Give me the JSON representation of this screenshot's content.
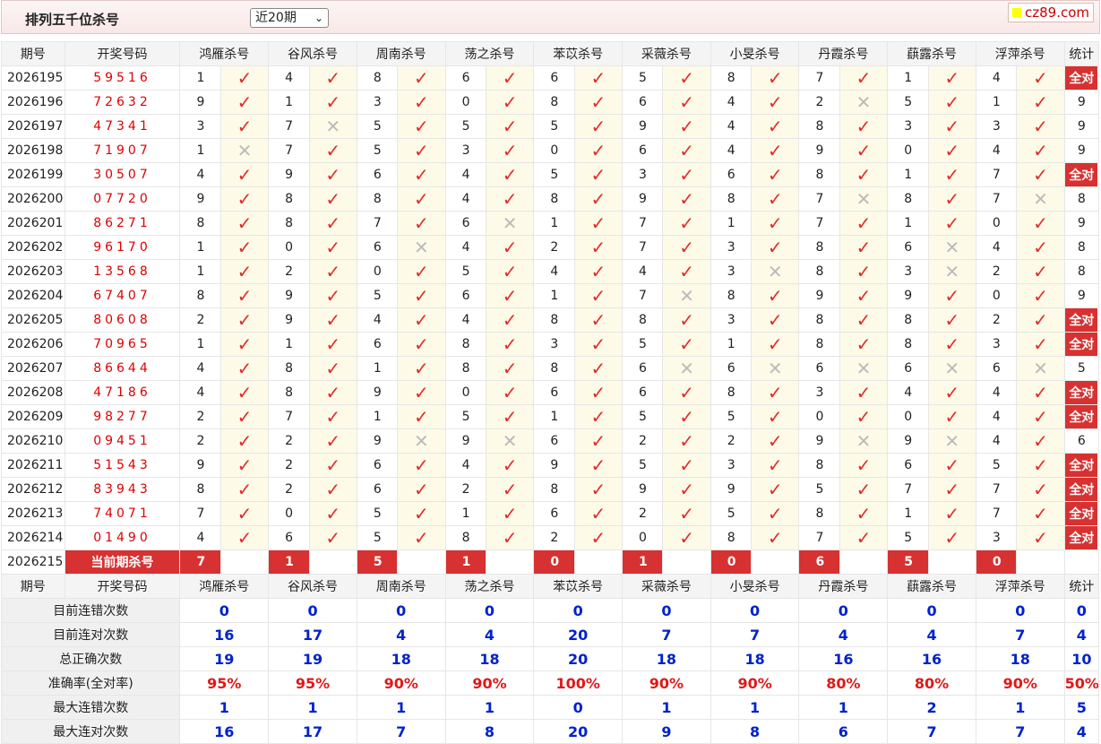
{
  "header": {
    "title": "排列五千位杀号",
    "period_select": "近20期",
    "brand": "cz89.com"
  },
  "columns": {
    "issue": "期号",
    "draw": "开奖号码",
    "experts": [
      "鸿雁杀号",
      "谷风杀号",
      "周南杀号",
      "荡之杀号",
      "苯苡杀号",
      "采薇杀号",
      "小旻杀号",
      "丹霞杀号",
      "蕻露杀号",
      "浮萍杀号"
    ],
    "stat": "统计"
  },
  "marks": {
    "ok": "✓",
    "no": "✕"
  },
  "rows": [
    {
      "issue": "2026195",
      "draw": "59516",
      "kills": [
        1,
        4,
        8,
        6,
        6,
        5,
        8,
        7,
        1,
        4
      ],
      "hits": [
        1,
        1,
        1,
        1,
        1,
        1,
        1,
        1,
        1,
        1
      ],
      "stat": "全对"
    },
    {
      "issue": "2026196",
      "draw": "72632",
      "kills": [
        9,
        1,
        3,
        0,
        8,
        6,
        4,
        2,
        5,
        1
      ],
      "hits": [
        1,
        1,
        1,
        1,
        1,
        1,
        1,
        0,
        1,
        1
      ],
      "stat": "9"
    },
    {
      "issue": "2026197",
      "draw": "47341",
      "kills": [
        3,
        7,
        5,
        5,
        5,
        9,
        4,
        8,
        3,
        3
      ],
      "hits": [
        1,
        0,
        1,
        1,
        1,
        1,
        1,
        1,
        1,
        1
      ],
      "stat": "9"
    },
    {
      "issue": "2026198",
      "draw": "71907",
      "kills": [
        1,
        7,
        5,
        3,
        0,
        6,
        4,
        9,
        0,
        4
      ],
      "hits": [
        0,
        1,
        1,
        1,
        1,
        1,
        1,
        1,
        1,
        1
      ],
      "stat": "9"
    },
    {
      "issue": "2026199",
      "draw": "30507",
      "kills": [
        4,
        9,
        6,
        4,
        5,
        3,
        6,
        8,
        1,
        7
      ],
      "hits": [
        1,
        1,
        1,
        1,
        1,
        1,
        1,
        1,
        1,
        1
      ],
      "stat": "全对"
    },
    {
      "issue": "2026200",
      "draw": "07720",
      "kills": [
        9,
        8,
        8,
        4,
        8,
        9,
        8,
        7,
        8,
        7
      ],
      "hits": [
        1,
        1,
        1,
        1,
        1,
        1,
        1,
        0,
        1,
        0
      ],
      "stat": "8"
    },
    {
      "issue": "2026201",
      "draw": "86271",
      "kills": [
        8,
        8,
        7,
        6,
        1,
        7,
        1,
        7,
        1,
        0
      ],
      "hits": [
        1,
        1,
        1,
        0,
        1,
        1,
        1,
        1,
        1,
        1
      ],
      "stat": "9"
    },
    {
      "issue": "2026202",
      "draw": "96170",
      "kills": [
        1,
        0,
        6,
        4,
        2,
        7,
        3,
        8,
        6,
        4
      ],
      "hits": [
        1,
        1,
        0,
        1,
        1,
        1,
        1,
        1,
        0,
        1
      ],
      "stat": "8"
    },
    {
      "issue": "2026203",
      "draw": "13568",
      "kills": [
        1,
        2,
        0,
        5,
        4,
        4,
        3,
        8,
        3,
        2
      ],
      "hits": [
        1,
        1,
        1,
        1,
        1,
        1,
        0,
        1,
        0,
        1
      ],
      "stat": "8"
    },
    {
      "issue": "2026204",
      "draw": "67407",
      "kills": [
        8,
        9,
        5,
        6,
        1,
        7,
        8,
        9,
        9,
        0
      ],
      "hits": [
        1,
        1,
        1,
        1,
        1,
        0,
        1,
        1,
        1,
        1
      ],
      "stat": "9"
    },
    {
      "issue": "2026205",
      "draw": "80608",
      "kills": [
        2,
        9,
        4,
        4,
        8,
        8,
        3,
        8,
        8,
        2
      ],
      "hits": [
        1,
        1,
        1,
        1,
        1,
        1,
        1,
        1,
        1,
        1
      ],
      "stat": "全对"
    },
    {
      "issue": "2026206",
      "draw": "70965",
      "kills": [
        1,
        1,
        6,
        8,
        3,
        5,
        1,
        8,
        8,
        3
      ],
      "hits": [
        1,
        1,
        1,
        1,
        1,
        1,
        1,
        1,
        1,
        1
      ],
      "stat": "全对"
    },
    {
      "issue": "2026207",
      "draw": "86644",
      "kills": [
        4,
        8,
        1,
        8,
        8,
        6,
        6,
        6,
        6,
        6
      ],
      "hits": [
        1,
        1,
        1,
        1,
        1,
        0,
        0,
        0,
        0,
        0
      ],
      "stat": "5"
    },
    {
      "issue": "2026208",
      "draw": "47186",
      "kills": [
        4,
        8,
        9,
        0,
        6,
        6,
        8,
        3,
        4,
        4
      ],
      "hits": [
        1,
        1,
        1,
        1,
        1,
        1,
        1,
        1,
        1,
        1
      ],
      "stat": "全对"
    },
    {
      "issue": "2026209",
      "draw": "98277",
      "kills": [
        2,
        7,
        1,
        5,
        1,
        5,
        5,
        0,
        0,
        4
      ],
      "hits": [
        1,
        1,
        1,
        1,
        1,
        1,
        1,
        1,
        1,
        1
      ],
      "stat": "全对"
    },
    {
      "issue": "2026210",
      "draw": "09451",
      "kills": [
        2,
        2,
        9,
        9,
        6,
        2,
        2,
        9,
        9,
        4
      ],
      "hits": [
        1,
        1,
        0,
        0,
        1,
        1,
        1,
        0,
        0,
        1
      ],
      "stat": "6"
    },
    {
      "issue": "2026211",
      "draw": "51543",
      "kills": [
        9,
        2,
        6,
        4,
        9,
        5,
        3,
        8,
        6,
        5
      ],
      "hits": [
        1,
        1,
        1,
        1,
        1,
        1,
        1,
        1,
        1,
        1
      ],
      "stat": "全对"
    },
    {
      "issue": "2026212",
      "draw": "83943",
      "kills": [
        8,
        2,
        6,
        2,
        8,
        9,
        9,
        5,
        7,
        7
      ],
      "hits": [
        1,
        1,
        1,
        1,
        1,
        1,
        1,
        1,
        1,
        1
      ],
      "stat": "全对"
    },
    {
      "issue": "2026213",
      "draw": "74071",
      "kills": [
        7,
        0,
        5,
        1,
        6,
        2,
        5,
        8,
        1,
        7
      ],
      "hits": [
        1,
        1,
        1,
        1,
        1,
        1,
        1,
        1,
        1,
        1
      ],
      "stat": "全对"
    },
    {
      "issue": "2026214",
      "draw": "01490",
      "kills": [
        4,
        6,
        5,
        8,
        2,
        0,
        8,
        7,
        5,
        3
      ],
      "hits": [
        1,
        1,
        1,
        1,
        1,
        1,
        1,
        1,
        1,
        1
      ],
      "stat": "全对"
    }
  ],
  "current": {
    "issue": "2026215",
    "label": "当前期杀号",
    "kills": [
      7,
      1,
      5,
      1,
      0,
      1,
      0,
      6,
      5,
      0
    ]
  },
  "stats": [
    {
      "label": "目前连错次数",
      "values": [
        "0",
        "0",
        "0",
        "0",
        "0",
        "0",
        "0",
        "0",
        "0",
        "0"
      ],
      "stat": "0",
      "style": "statval"
    },
    {
      "label": "目前连对次数",
      "values": [
        "16",
        "17",
        "4",
        "4",
        "20",
        "7",
        "7",
        "4",
        "4",
        "7"
      ],
      "stat": "4",
      "style": "statval"
    },
    {
      "label": "总正确次数",
      "values": [
        "19",
        "19",
        "18",
        "18",
        "20",
        "18",
        "18",
        "16",
        "16",
        "18"
      ],
      "stat": "10",
      "style": "statval"
    },
    {
      "label": "准确率(全对率)",
      "values": [
        "95%",
        "95%",
        "90%",
        "90%",
        "100%",
        "90%",
        "90%",
        "80%",
        "80%",
        "90%"
      ],
      "stat": "50%",
      "style": "rate"
    },
    {
      "label": "最大连错次数",
      "values": [
        "1",
        "1",
        "1",
        "1",
        "0",
        "1",
        "1",
        "1",
        "2",
        "1"
      ],
      "stat": "5",
      "style": "statval"
    },
    {
      "label": "最大连对次数",
      "values": [
        "16",
        "17",
        "7",
        "8",
        "20",
        "9",
        "8",
        "6",
        "7",
        "7"
      ],
      "stat": "4",
      "style": "statval"
    }
  ]
}
